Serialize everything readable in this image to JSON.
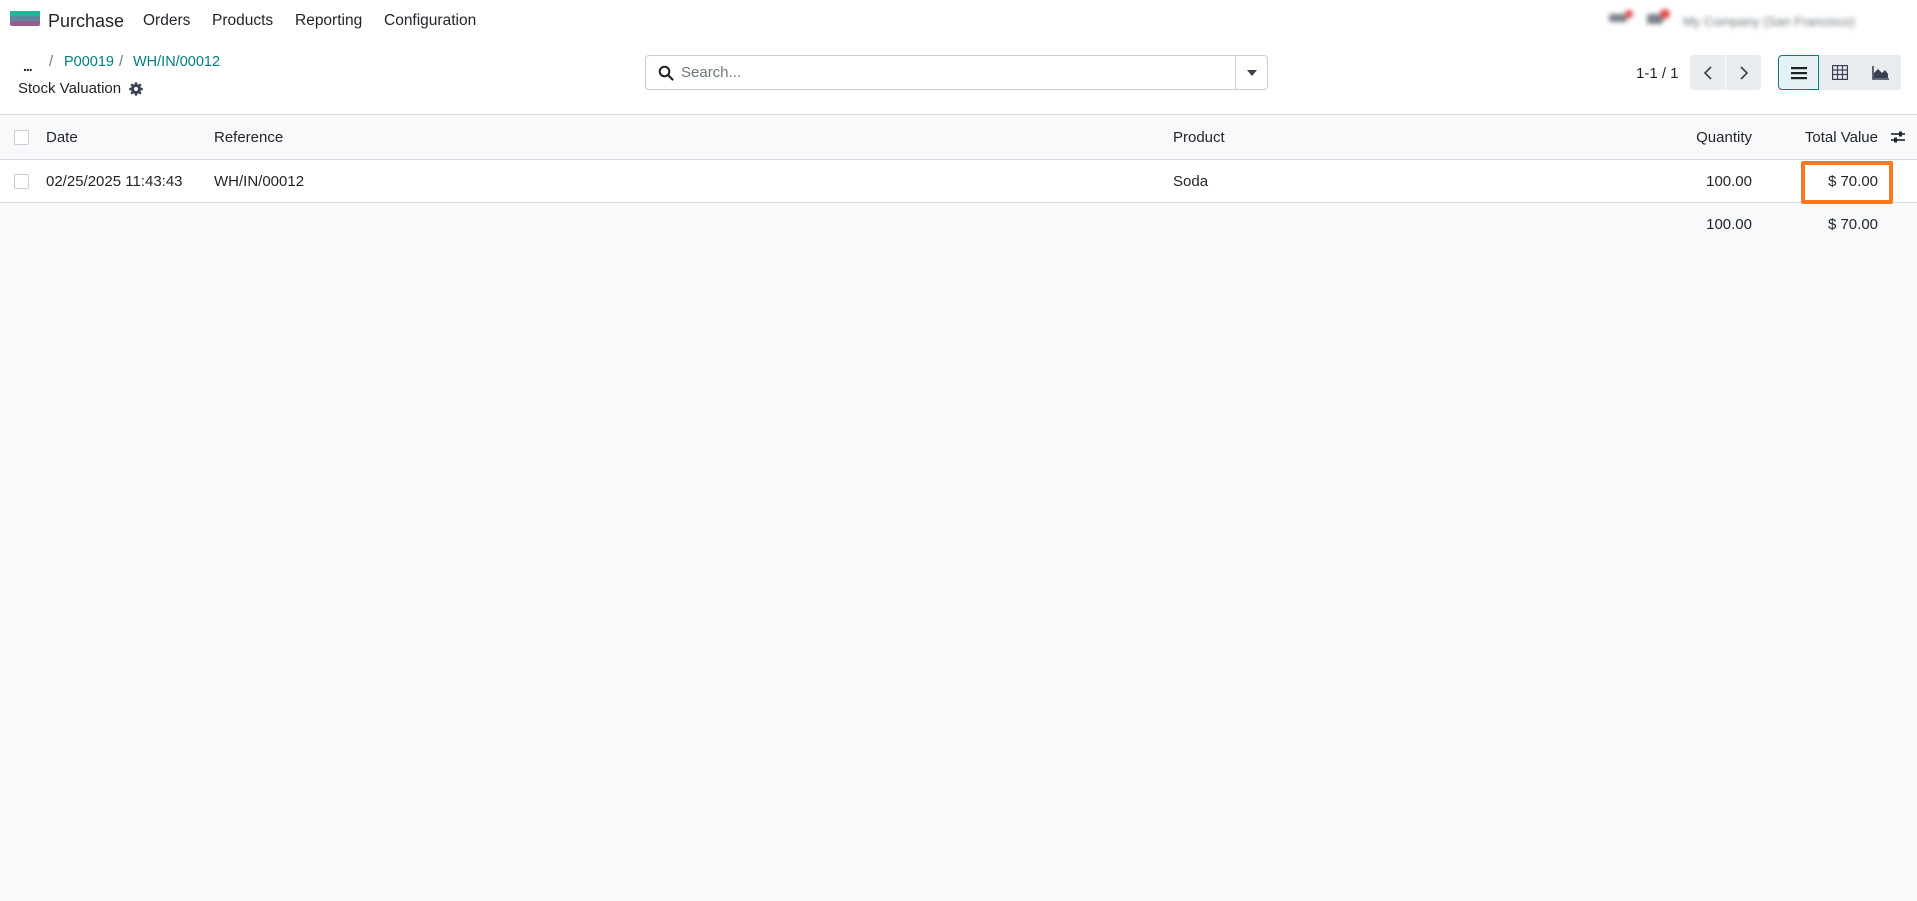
{
  "navbar": {
    "app_name": "Purchase",
    "menu": [
      "Orders",
      "Products",
      "Reporting",
      "Configuration"
    ],
    "systray": {
      "company": "My Company (San Francisco)"
    }
  },
  "breadcrumb": {
    "ellipsis": "...",
    "items": [
      "P00019",
      "WH/IN/00012"
    ],
    "separator": "/",
    "current": "Stock Valuation"
  },
  "search": {
    "placeholder": "Search..."
  },
  "pager": {
    "value": "1-1 / 1"
  },
  "views": [
    "list-view",
    "pivot-view",
    "graph-view"
  ],
  "table": {
    "columns": [
      "Date",
      "Reference",
      "Product",
      "Quantity",
      "Total Value"
    ],
    "rows": [
      {
        "date": "02/25/2025 11:43:43",
        "reference": "WH/IN/00012",
        "product": "Soda",
        "quantity": "100.00",
        "total_value": "$ 70.00"
      }
    ],
    "totals": {
      "quantity": "100.00",
      "total_value": "$ 70.00"
    }
  },
  "colors": {
    "accent": "#017e84",
    "highlight": "#f7781f"
  }
}
